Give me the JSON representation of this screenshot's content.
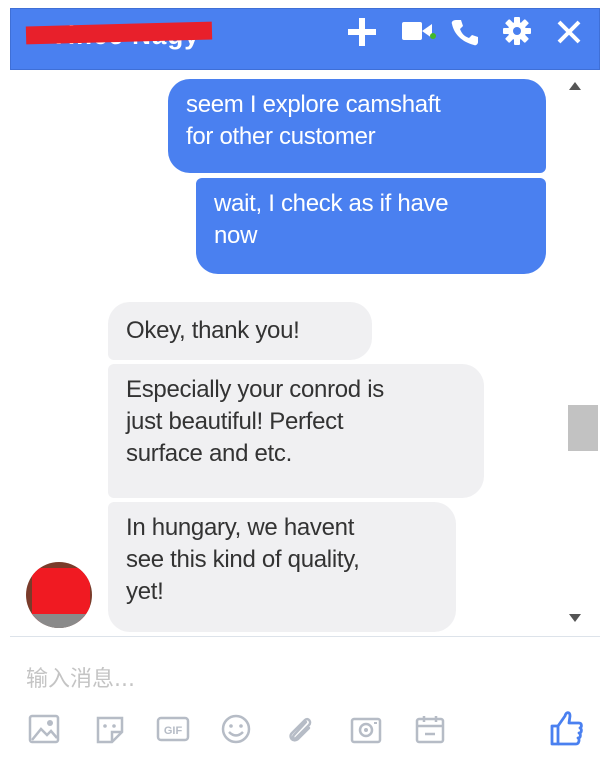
{
  "header": {
    "contact_name": "Vince Nagy",
    "icons": [
      "plus-icon",
      "video-call-icon",
      "phone-icon",
      "gear-icon",
      "close-icon"
    ],
    "accent_color": "#4a80f0"
  },
  "messages": [
    {
      "direction": "outgoing",
      "text": "seem I explore camshaft\nfor other customer"
    },
    {
      "direction": "outgoing",
      "text": "wait, I check as if have\nnow"
    },
    {
      "direction": "incoming",
      "text": "Okey, thank you!"
    },
    {
      "direction": "incoming",
      "text": "Especially your conrod is\njust beautiful! Perfect\nsurface and etc."
    },
    {
      "direction": "incoming",
      "text": "In hungary, we havent\nsee this kind of quality,\nyet!"
    }
  ],
  "composer": {
    "placeholder": "输入消息...",
    "tools": [
      "image-icon",
      "sticker-icon",
      "gif-icon",
      "emoji-icon",
      "attachment-icon",
      "camera-icon",
      "calendar-icon"
    ],
    "gif_label": "GIF",
    "send_icon": "thumbs-up-icon"
  }
}
